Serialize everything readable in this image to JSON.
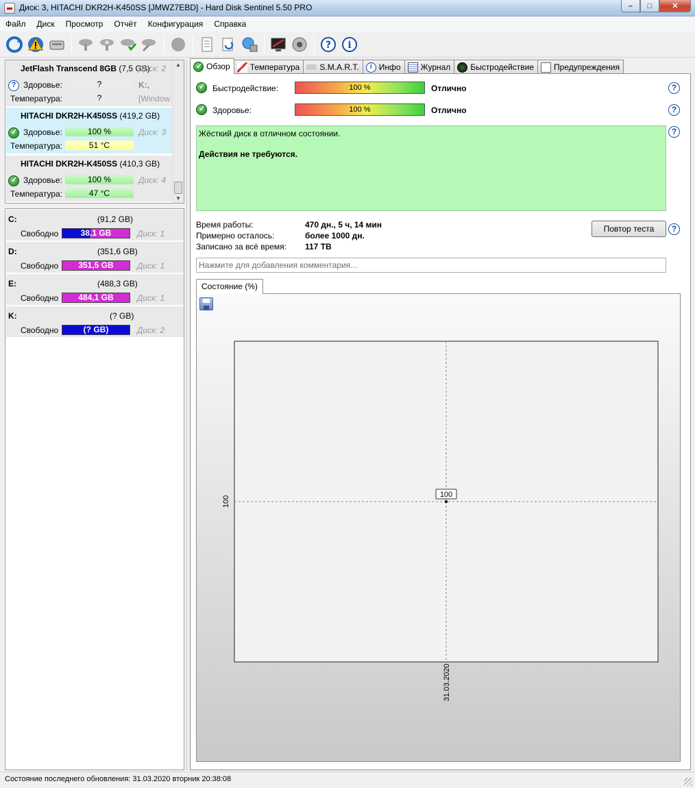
{
  "window": {
    "title": "Диск: 3, HITACHI DKR2H-K450SS [JMWZ7EBD]  -  Hard Disk Sentinel 5.50 PRO",
    "min": "–",
    "max": "□",
    "close": "✕"
  },
  "menu": [
    "Файл",
    "Диск",
    "Просмотр",
    "Отчёт",
    "Конфигурация",
    "Справка"
  ],
  "disks": [
    {
      "name": "JetFlash Transcend 8GB",
      "size": "(7,5 GB)",
      "disk": "Диск: 2",
      "health_label": "Здоровье:",
      "health": "?",
      "extra_health": "K:,",
      "temp_label": "Температура:",
      "temp": "?",
      "extra_temp": "[Window"
    },
    {
      "name": "HITACHI DKR2H-K450SS",
      "size": "(419,2 GB)",
      "disk": "Диск: 3",
      "health_label": "Здоровье:",
      "health": "100 %",
      "temp_label": "Температура:",
      "temp": "51 °C"
    },
    {
      "name": "HITACHI DKR2H-K450SS",
      "size": "(410,3 GB)",
      "disk": "Диск: 4",
      "health_label": "Здоровье:",
      "health": "100 %",
      "temp_label": "Температура:",
      "temp": "47 °C"
    }
  ],
  "partitions": [
    {
      "letter": "C:",
      "size": "(91,2 GB)",
      "free_label": "Свободно",
      "free": "38,1 GB",
      "disk": "Диск: 1",
      "free_fraction": 0.42,
      "fill": "#0b0bd6",
      "rest": "#d42bd4"
    },
    {
      "letter": "D:",
      "size": "(351,6 GB)",
      "free_label": "Свободно",
      "free": "351,5 GB",
      "disk": "Диск: 1",
      "free_fraction": 1.0,
      "fill": "#d42bd4",
      "rest": "#d42bd4"
    },
    {
      "letter": "E:",
      "size": "(488,3 GB)",
      "free_label": "Свободно",
      "free": "484,1 GB",
      "disk": "Диск: 1",
      "free_fraction": 0.99,
      "fill": "#d42bd4",
      "rest": "#d42bd4"
    },
    {
      "letter": "K:",
      "size": "(? GB)",
      "free_label": "Свободно",
      "free": "(? GB)",
      "disk": "Диск: 2",
      "free_fraction": 1.0,
      "fill": "#0b0bd6",
      "rest": "#0b0bd6"
    }
  ],
  "tabs": [
    "Обзор",
    "Температура",
    "S.M.A.R.T.",
    "Инфо",
    "Журнал",
    "Быстродействие",
    "Предупреждения"
  ],
  "overview": {
    "performance_label": "Быстродействие:",
    "performance_value": "100 %",
    "performance_percent": 100,
    "performance_rating": "Отлично",
    "health_label": "Здоровье:",
    "health_value": "100 %",
    "health_percent": 100,
    "health_rating": "Отлично",
    "message_line1": "Жёсткий диск в отличном состоянии.",
    "message_line2": "Действия не требуются.",
    "uptime_label": "Время работы:",
    "uptime_value": "470 дн., 5 ч, 14 мин",
    "remaining_label": "Примерно осталось:",
    "remaining_value": "более 1000 дн.",
    "written_label": "Записано за всё время:",
    "written_value": "117 TB",
    "retest_button": "Повтор теста",
    "comment_placeholder": "Нажмите для добавления комментария...",
    "chart_tab": "Состояние (%)",
    "help": "?"
  },
  "chart_data": {
    "type": "line",
    "x": [
      "31.03.2020"
    ],
    "series": [
      {
        "values": [
          100
        ]
      }
    ],
    "tick_labels_y": [
      "100"
    ],
    "tick_labels_x": [
      "31.03.2020"
    ],
    "data_labels": [
      "100"
    ]
  },
  "status": "Состояние последнего обновления: 31.03.2020 вторник 20:38:08",
  "colors": {
    "good": "#b6f9b6",
    "selected": "#d4f1fb",
    "accent": "#1a4ea8"
  }
}
